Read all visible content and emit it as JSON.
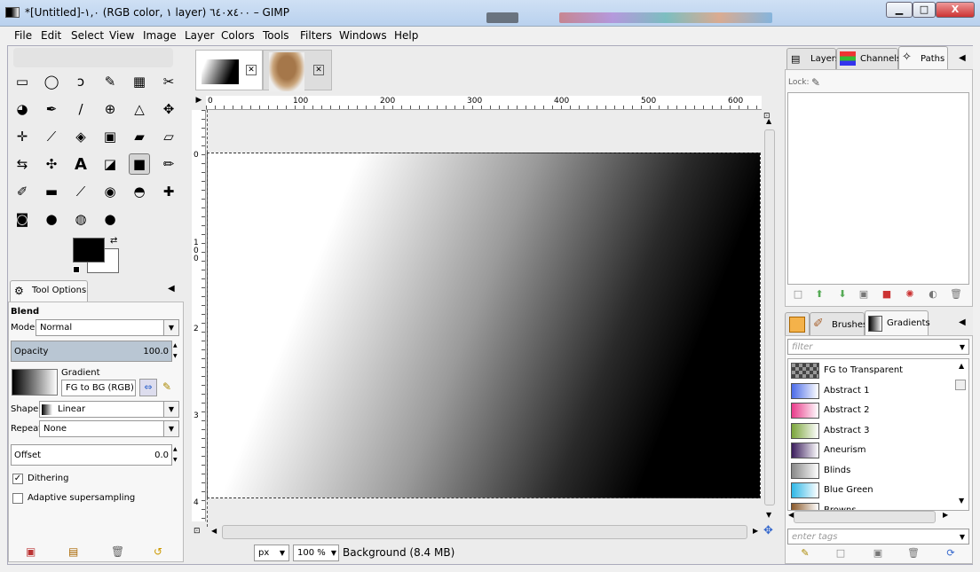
{
  "window": {
    "title": "*[Untitled]-١,٠ (RGB color, ١ layer) ٦٤٠x٤٠٠ – GIMP",
    "min": "▁",
    "max": "□",
    "close": "X"
  },
  "menu": [
    "File",
    "Edit",
    "Select",
    "View",
    "Image",
    "Layer",
    "Colors",
    "Tools",
    "Filters",
    "Windows",
    "Help"
  ],
  "toolbox": {
    "rows": [
      [
        "rect-select-icon",
        "ellipse-select-icon",
        "free-select-icon",
        "fuzzy-select-icon",
        "color-select-icon",
        "scissors-icon"
      ],
      [
        "foreground-select-icon",
        "paths-icon",
        "color-picker-icon",
        "zoom-icon",
        "measure-icon",
        "move-icon"
      ],
      [
        "align-icon",
        "crop-icon",
        "rotate-icon",
        "scale-icon",
        "shear-icon",
        "perspective-icon"
      ],
      [
        "flip-icon",
        "cage-icon",
        "text-icon",
        "bucket-fill-icon",
        "blend-icon",
        "pencil-icon"
      ],
      [
        "paintbrush-icon",
        "eraser-icon",
        "airbrush-icon",
        "ink-icon",
        "clone-icon",
        "heal-icon"
      ],
      [
        "perspective-clone-icon",
        "blur-icon",
        "smudge-icon",
        "dodge-burn-icon"
      ]
    ],
    "glyphs": [
      [
        "▭",
        "◯",
        "ↄ",
        "✎",
        "▦",
        "✂"
      ],
      [
        "◕",
        "✒",
        "/",
        "⊕",
        "△",
        "✥"
      ],
      [
        "✛",
        "⟋",
        "◈",
        "▣",
        "▰",
        "▱"
      ],
      [
        "⇆",
        "✣",
        "A",
        "◪",
        "■",
        "✏"
      ],
      [
        "✐",
        "▬",
        "⟋",
        "◉",
        "◓",
        "✚"
      ],
      [
        "◙",
        "●",
        "◍",
        "●"
      ]
    ]
  },
  "tool_options": {
    "tab": "Tool Options",
    "heading": "Blend",
    "mode_label": "Mode:",
    "mode_value": "Normal",
    "opacity_label": "Opacity",
    "opacity_value": "100.0",
    "gradient_label": "Gradient",
    "gradient_value": "FG to BG (RGB)",
    "shape_label": "Shape:",
    "shape_value": "Linear",
    "repeat_label": "Repeat:",
    "repeat_value": "None",
    "offset_label": "Offset",
    "offset_value": "0.0",
    "dithering_label": "Dithering",
    "dithering_checked": true,
    "adaptive_label": "Adaptive supersampling",
    "adaptive_checked": false
  },
  "canvas": {
    "ruler_h": [
      "0",
      "100",
      "200",
      "300",
      "400",
      "500",
      "600"
    ],
    "ruler_v": [
      "0",
      "1 0 0",
      "2",
      "3",
      "4"
    ],
    "unit": "px",
    "zoom": "100 %",
    "status": "Background (8.4 MB)"
  },
  "dock": {
    "tabs": [
      "Layers",
      "Channels",
      "Paths"
    ],
    "lock_label": "Lock:",
    "brush_tabs": [
      "Brushes",
      "Gradients"
    ],
    "filter_placeholder": "filter",
    "tags_placeholder": "enter tags",
    "gradients": [
      {
        "name": "FG to Transparent",
        "color": "#555"
      },
      {
        "name": "Abstract 1",
        "color": "#4b6be8"
      },
      {
        "name": "Abstract 2",
        "color": "#e83b8a"
      },
      {
        "name": "Abstract 3",
        "color": "#7aa43a"
      },
      {
        "name": "Aneurism",
        "color": "#3a1c5c"
      },
      {
        "name": "Blinds",
        "color": "#888"
      },
      {
        "name": "Blue Green",
        "color": "#2fb7e6"
      },
      {
        "name": "Browns",
        "color": "#8b5a2b"
      }
    ]
  }
}
